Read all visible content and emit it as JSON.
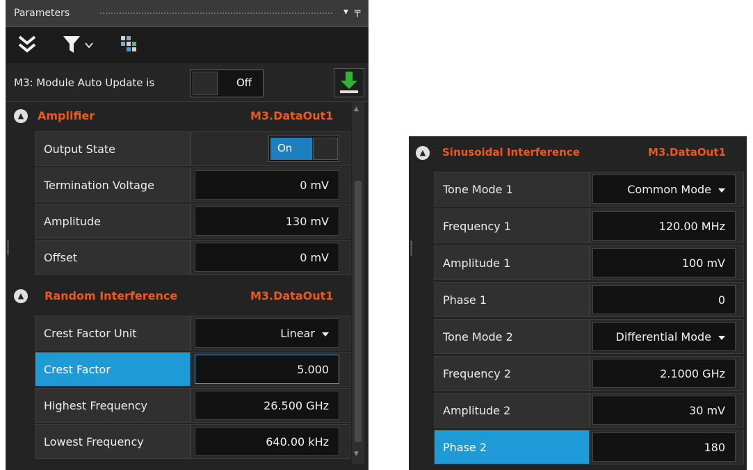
{
  "left_panel": {
    "title": "Parameters",
    "auto_update": {
      "label": "M3: Module Auto Update is",
      "state": "Off"
    },
    "amplifier": {
      "title": "Amplifier",
      "module": "M3.DataOut1",
      "rows": [
        {
          "label": "Output State",
          "value": "On"
        },
        {
          "label": "Termination Voltage",
          "value": "0 mV"
        },
        {
          "label": "Amplitude",
          "value": "130 mV"
        },
        {
          "label": "Offset",
          "value": "0 mV"
        }
      ]
    },
    "random": {
      "title": "Random Interference",
      "module": "M3.DataOut1",
      "rows": [
        {
          "label": "Crest Factor Unit",
          "value": "Linear"
        },
        {
          "label": "Crest Factor",
          "value": "5.000"
        },
        {
          "label": "Highest Frequency",
          "value": "26.500 GHz"
        },
        {
          "label": "Lowest Frequency",
          "value": "640.00 kHz"
        }
      ]
    }
  },
  "right_panel": {
    "title": "Sinusoidal Interference",
    "module": "M3.DataOut1",
    "rows": [
      {
        "label": "Tone Mode 1",
        "value": "Common Mode"
      },
      {
        "label": "Frequency 1",
        "value": "120.00 MHz"
      },
      {
        "label": "Amplitude 1",
        "value": "100 mV"
      },
      {
        "label": "Phase 1",
        "value": "0"
      },
      {
        "label": "Tone Mode 2",
        "value": "Differential Mode"
      },
      {
        "label": "Frequency 2",
        "value": "2.1000 GHz"
      },
      {
        "label": "Amplitude 2",
        "value": "30 mV"
      },
      {
        "label": "Phase 2",
        "value": "180"
      }
    ]
  },
  "icons": [
    "collapse-all-icon",
    "filter-icon",
    "chevron-down-icon",
    "table-icon",
    "download-icon",
    "pin-icon",
    "section-collapse-icon"
  ],
  "colors": {
    "accent": "#f0571b",
    "selection": "#1e9bd7"
  }
}
